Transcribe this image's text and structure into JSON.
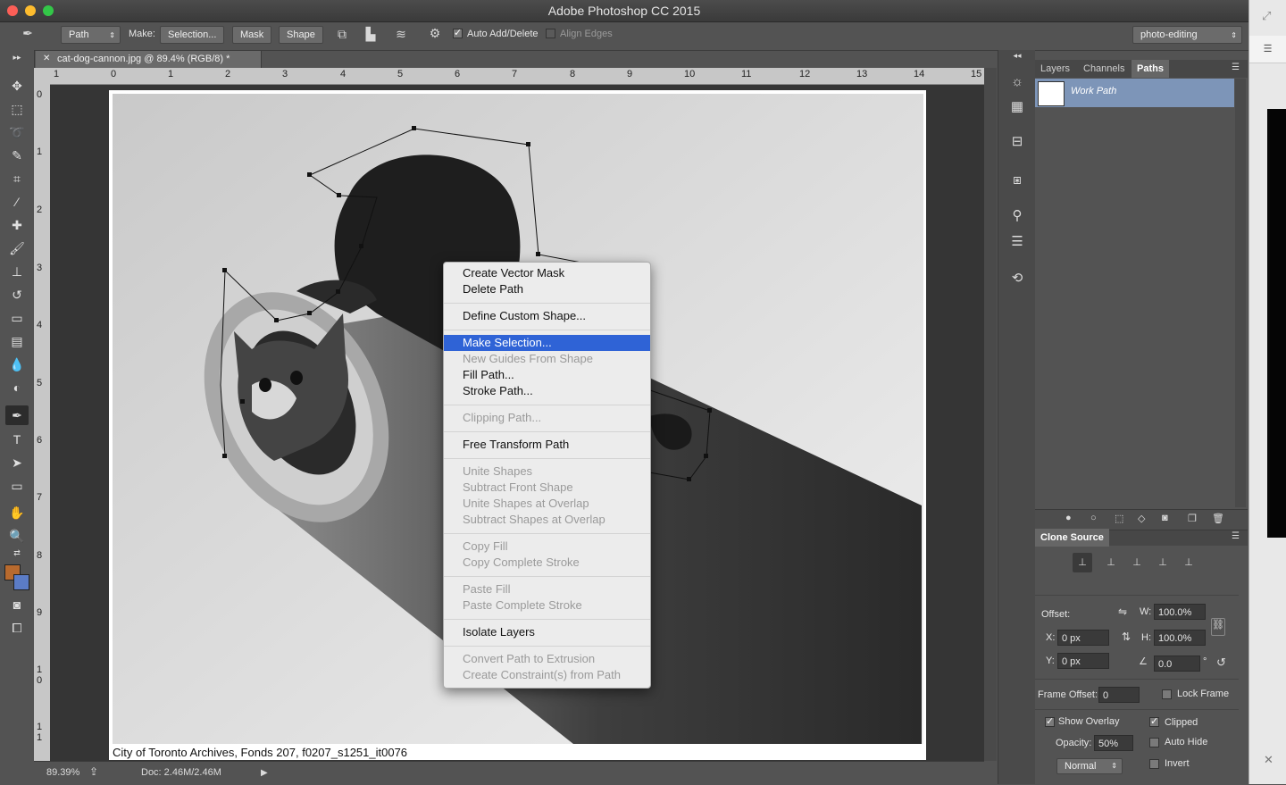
{
  "window": {
    "title": "Adobe Photoshop CC 2015"
  },
  "options": {
    "path_mode": "Path",
    "make_label": "Make:",
    "selection_btn": "Selection...",
    "mask_btn": "Mask",
    "shape_btn": "Shape",
    "auto_add_delete": "Auto Add/Delete",
    "align_edges": "Align Edges",
    "workspace": "photo-editing"
  },
  "document": {
    "tab_title": "cat-dog-cannon.jpg @ 89.4% (RGB/8) *",
    "ruler_top": [
      "1",
      "0",
      "1",
      "2",
      "3",
      "4",
      "5",
      "6",
      "7",
      "8",
      "9",
      "10",
      "11",
      "12",
      "13",
      "14",
      "15"
    ],
    "ruler_left": [
      "0",
      "1",
      "2",
      "3",
      "4",
      "5",
      "6",
      "7",
      "8",
      "9",
      "1",
      "0",
      "1",
      "1"
    ],
    "caption": "City of Toronto Archives, Fonds 207, f0207_s1251_it0076",
    "zoom": "89.39%",
    "doc_size": "Doc: 2.46M/2.46M"
  },
  "context_menu": {
    "items": [
      "Create Vector Mask",
      "Delete Path",
      "Define Custom Shape...",
      "Make Selection...",
      "New Guides From Shape",
      "Fill Path...",
      "Stroke Path...",
      "Clipping Path...",
      "Free Transform Path",
      "Unite Shapes",
      "Subtract Front Shape",
      "Unite Shapes at Overlap",
      "Subtract Shapes at Overlap",
      "Copy Fill",
      "Copy Complete Stroke",
      "Paste Fill",
      "Paste Complete Stroke",
      "Isolate Layers",
      "Convert Path to Extrusion",
      "Create Constraint(s) from Path"
    ],
    "highlight_color": "#2f63d6"
  },
  "paths_panel": {
    "tabs": [
      "Layers",
      "Channels",
      "Paths"
    ],
    "active_tab": "Paths",
    "work_path": "Work Path"
  },
  "clone_source": {
    "title": "Clone Source",
    "offset_label": "Offset:",
    "w_label": "W:",
    "w_value": "100.0%",
    "h_label": "H:",
    "h_value": "100.0%",
    "x_label": "X:",
    "x_value": "0 px",
    "y_label": "Y:",
    "y_value": "0 px",
    "angle_value": "0.0",
    "degree": "°",
    "frame_offset_label": "Frame Offset:",
    "frame_offset_value": "0",
    "lock_frame": "Lock Frame",
    "show_overlay": "Show Overlay",
    "clipped": "Clipped",
    "opacity_label": "Opacity:",
    "opacity_value": "50%",
    "auto_hide": "Auto Hide",
    "invert": "Invert",
    "blend_mode": "Normal"
  }
}
